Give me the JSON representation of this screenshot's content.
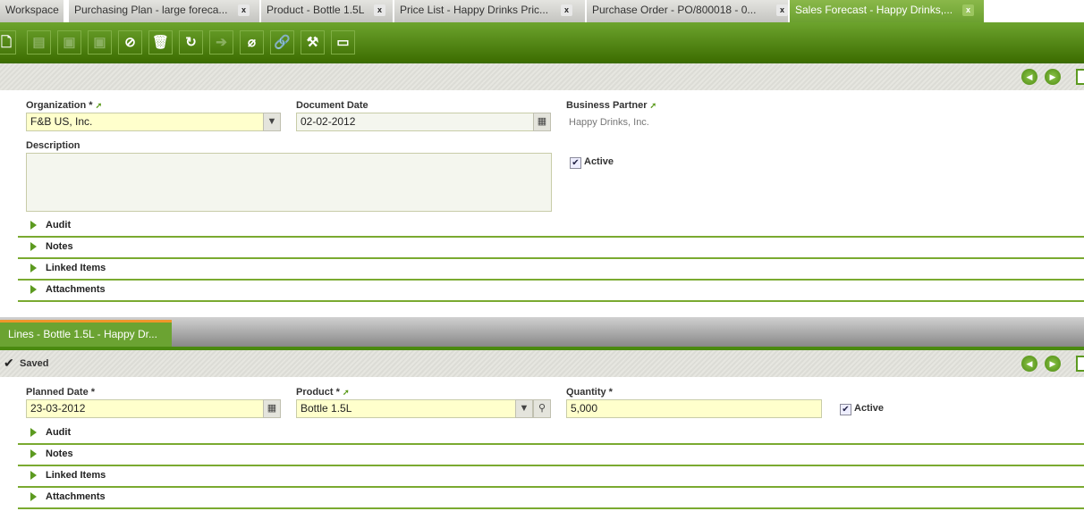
{
  "tabs": [
    {
      "label": "Workspace"
    },
    {
      "label": "Purchasing Plan - large foreca...",
      "close": "x"
    },
    {
      "label": "Product - Bottle 1.5L",
      "close": "x"
    },
    {
      "label": "Price List - Happy Drinks Pric...",
      "close": "x"
    },
    {
      "label": "Purchase Order - PO/800018 - 0...",
      "close": "x"
    },
    {
      "label": "Sales Forecast - Happy Drinks,...",
      "close": "x"
    }
  ],
  "toolbar": [
    "new-document-icon",
    "new-row-icon",
    "save-icon",
    "save-close-icon",
    "undo-icon",
    "delete-icon",
    "refresh-icon",
    "export-icon",
    "attachment-icon",
    "link-icon",
    "settings-icon",
    "layout-icon"
  ],
  "header": {
    "organization": {
      "label": "Organization *",
      "value": "F&B US, Inc."
    },
    "document_date": {
      "label": "Document Date",
      "value": "02-02-2012"
    },
    "business_partner": {
      "label": "Business Partner",
      "value": "Happy Drinks, Inc."
    },
    "description": {
      "label": "Description",
      "value": ""
    },
    "active": {
      "label": "Active",
      "checked": true
    },
    "sections": [
      "Audit",
      "Notes",
      "Linked Items",
      "Attachments"
    ]
  },
  "lines": {
    "tab_label": "Lines - Bottle 1.5L - Happy Dr...",
    "status": "Saved",
    "planned_date": {
      "label": "Planned Date *",
      "value": "23-03-2012"
    },
    "product": {
      "label": "Product *",
      "value": "Bottle 1.5L"
    },
    "quantity": {
      "label": "Quantity *",
      "value": "5,000"
    },
    "active": {
      "label": "Active",
      "checked": true
    },
    "sections": [
      "Audit",
      "Notes",
      "Linked Items",
      "Attachments"
    ]
  },
  "colors": {
    "accent": "#5c9a20",
    "field": "#ffffcc"
  }
}
